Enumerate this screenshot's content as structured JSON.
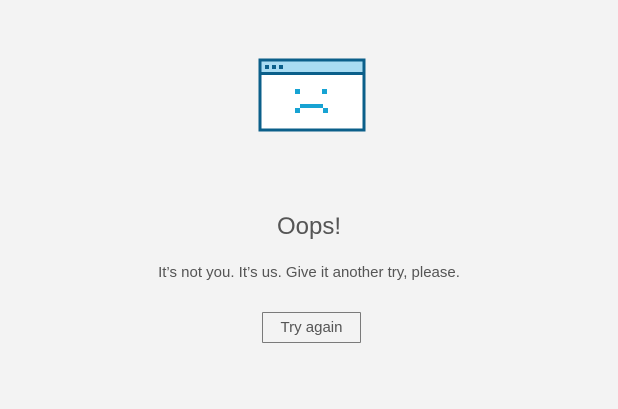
{
  "error": {
    "illustration_icon": "sad-browser-window-icon",
    "title": "Oops!",
    "message": "It’s not you. It’s us. Give it another try, please.",
    "retry_label": "Try again"
  },
  "colors": {
    "background": "#f3f3f3",
    "text": "#555555",
    "icon_border": "#0b5f8a",
    "icon_bar": "#a9dcf2",
    "icon_face": "#17a3d3",
    "button_border": "#7a7a7a"
  }
}
